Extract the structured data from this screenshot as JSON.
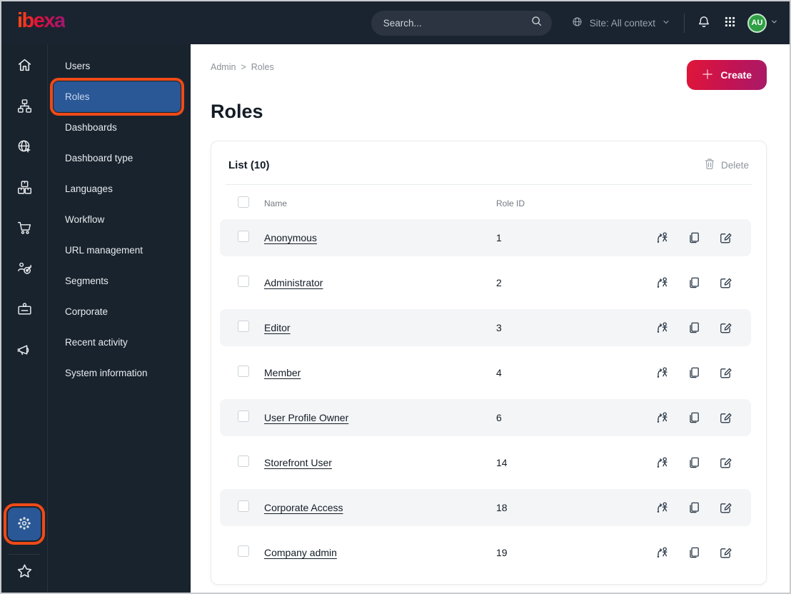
{
  "topbar": {
    "logo_text": "ibexa",
    "search": {
      "placeholder": "Search..."
    },
    "site_context_label": "Site: All context",
    "avatar_initials": "AU"
  },
  "sidebar": {
    "nav_icons": [
      "home",
      "sitemap",
      "globe-cursor",
      "boxes",
      "shopping-cart",
      "person-target",
      "id-badge",
      "megaphone"
    ],
    "bottom_icons": [
      "gear",
      "star"
    ],
    "highlighted_icon": "gear"
  },
  "menu": {
    "items": [
      {
        "label": "Users",
        "selected": false
      },
      {
        "label": "Roles",
        "selected": true
      },
      {
        "label": "Dashboards",
        "selected": false
      },
      {
        "label": "Dashboard type",
        "selected": false
      },
      {
        "label": "Languages",
        "selected": false
      },
      {
        "label": "Workflow",
        "selected": false
      },
      {
        "label": "URL management",
        "selected": false
      },
      {
        "label": "Segments",
        "selected": false
      },
      {
        "label": "Corporate",
        "selected": false
      },
      {
        "label": "Recent activity",
        "selected": false
      },
      {
        "label": "System information",
        "selected": false
      }
    ]
  },
  "main": {
    "breadcrumb": {
      "items": [
        "Admin",
        "Roles"
      ],
      "separator": ">"
    },
    "create_button_label": "Create",
    "page_title": "Roles",
    "list_card": {
      "title": "List (10)",
      "delete_button_label": "Delete",
      "columns": [
        "Name",
        "Role ID"
      ],
      "rows": [
        {
          "name": "Anonymous",
          "role_id": "1"
        },
        {
          "name": "Administrator",
          "role_id": "2"
        },
        {
          "name": "Editor",
          "role_id": "3"
        },
        {
          "name": "Member",
          "role_id": "4"
        },
        {
          "name": "User Profile Owner",
          "role_id": "6"
        },
        {
          "name": "Storefront User",
          "role_id": "14"
        },
        {
          "name": "Corporate Access",
          "role_id": "18"
        },
        {
          "name": "Company admin",
          "role_id": "19"
        }
      ]
    }
  },
  "colors": {
    "topbar_bg": "#1a2430",
    "sidebar_bg": "#19232e",
    "selected_item_bg": "#2a5795",
    "annotation_orange": "#f04a17",
    "create_gradient_start": "#e01638",
    "create_gradient_end": "#a81a68",
    "avatar_green": "#2f9e44",
    "row_stripe": "#f4f5f7",
    "text_dark": "#131c26",
    "text_muted": "#8b9096"
  }
}
